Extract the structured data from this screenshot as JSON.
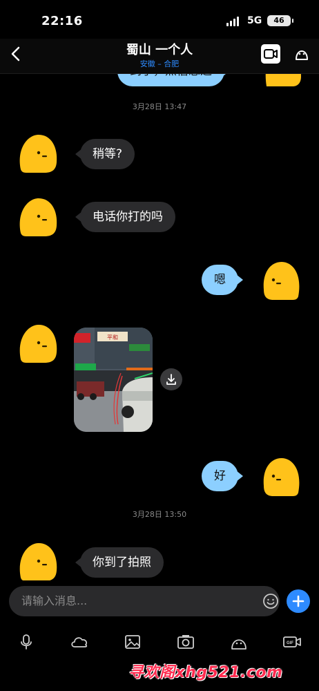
{
  "status": {
    "time": "22:16",
    "network": "5G",
    "battery": "46"
  },
  "header": {
    "title": "蜀山 一个人",
    "subtitle": "安徽 – 合肥"
  },
  "partial_message": {
    "text": "到了，点信息过"
  },
  "messages": {
    "ts1": "3月28日 13:47",
    "m1": "稍等?",
    "m2": "电话你打的吗",
    "m3": "嗯",
    "m5": "好",
    "ts2": "3月28日 13:50",
    "m6": "你到了拍照"
  },
  "photo_sign": "平和",
  "input": {
    "placeholder": "请输入消息..."
  },
  "watermark": "寻欢阁xhg521.com",
  "colors": {
    "accent": "#2e8bff",
    "outgoing_bubble": "#8ccfff",
    "incoming_bubble": "#2b2b2d",
    "avatar": "#ffc21a"
  },
  "icons": {
    "header": [
      "back-icon",
      "video-call-icon",
      "profile-icon"
    ],
    "toolbar": [
      "microphone-icon",
      "cloud-icon",
      "image-icon",
      "camera-icon",
      "sticker-icon",
      "gif-icon"
    ]
  }
}
